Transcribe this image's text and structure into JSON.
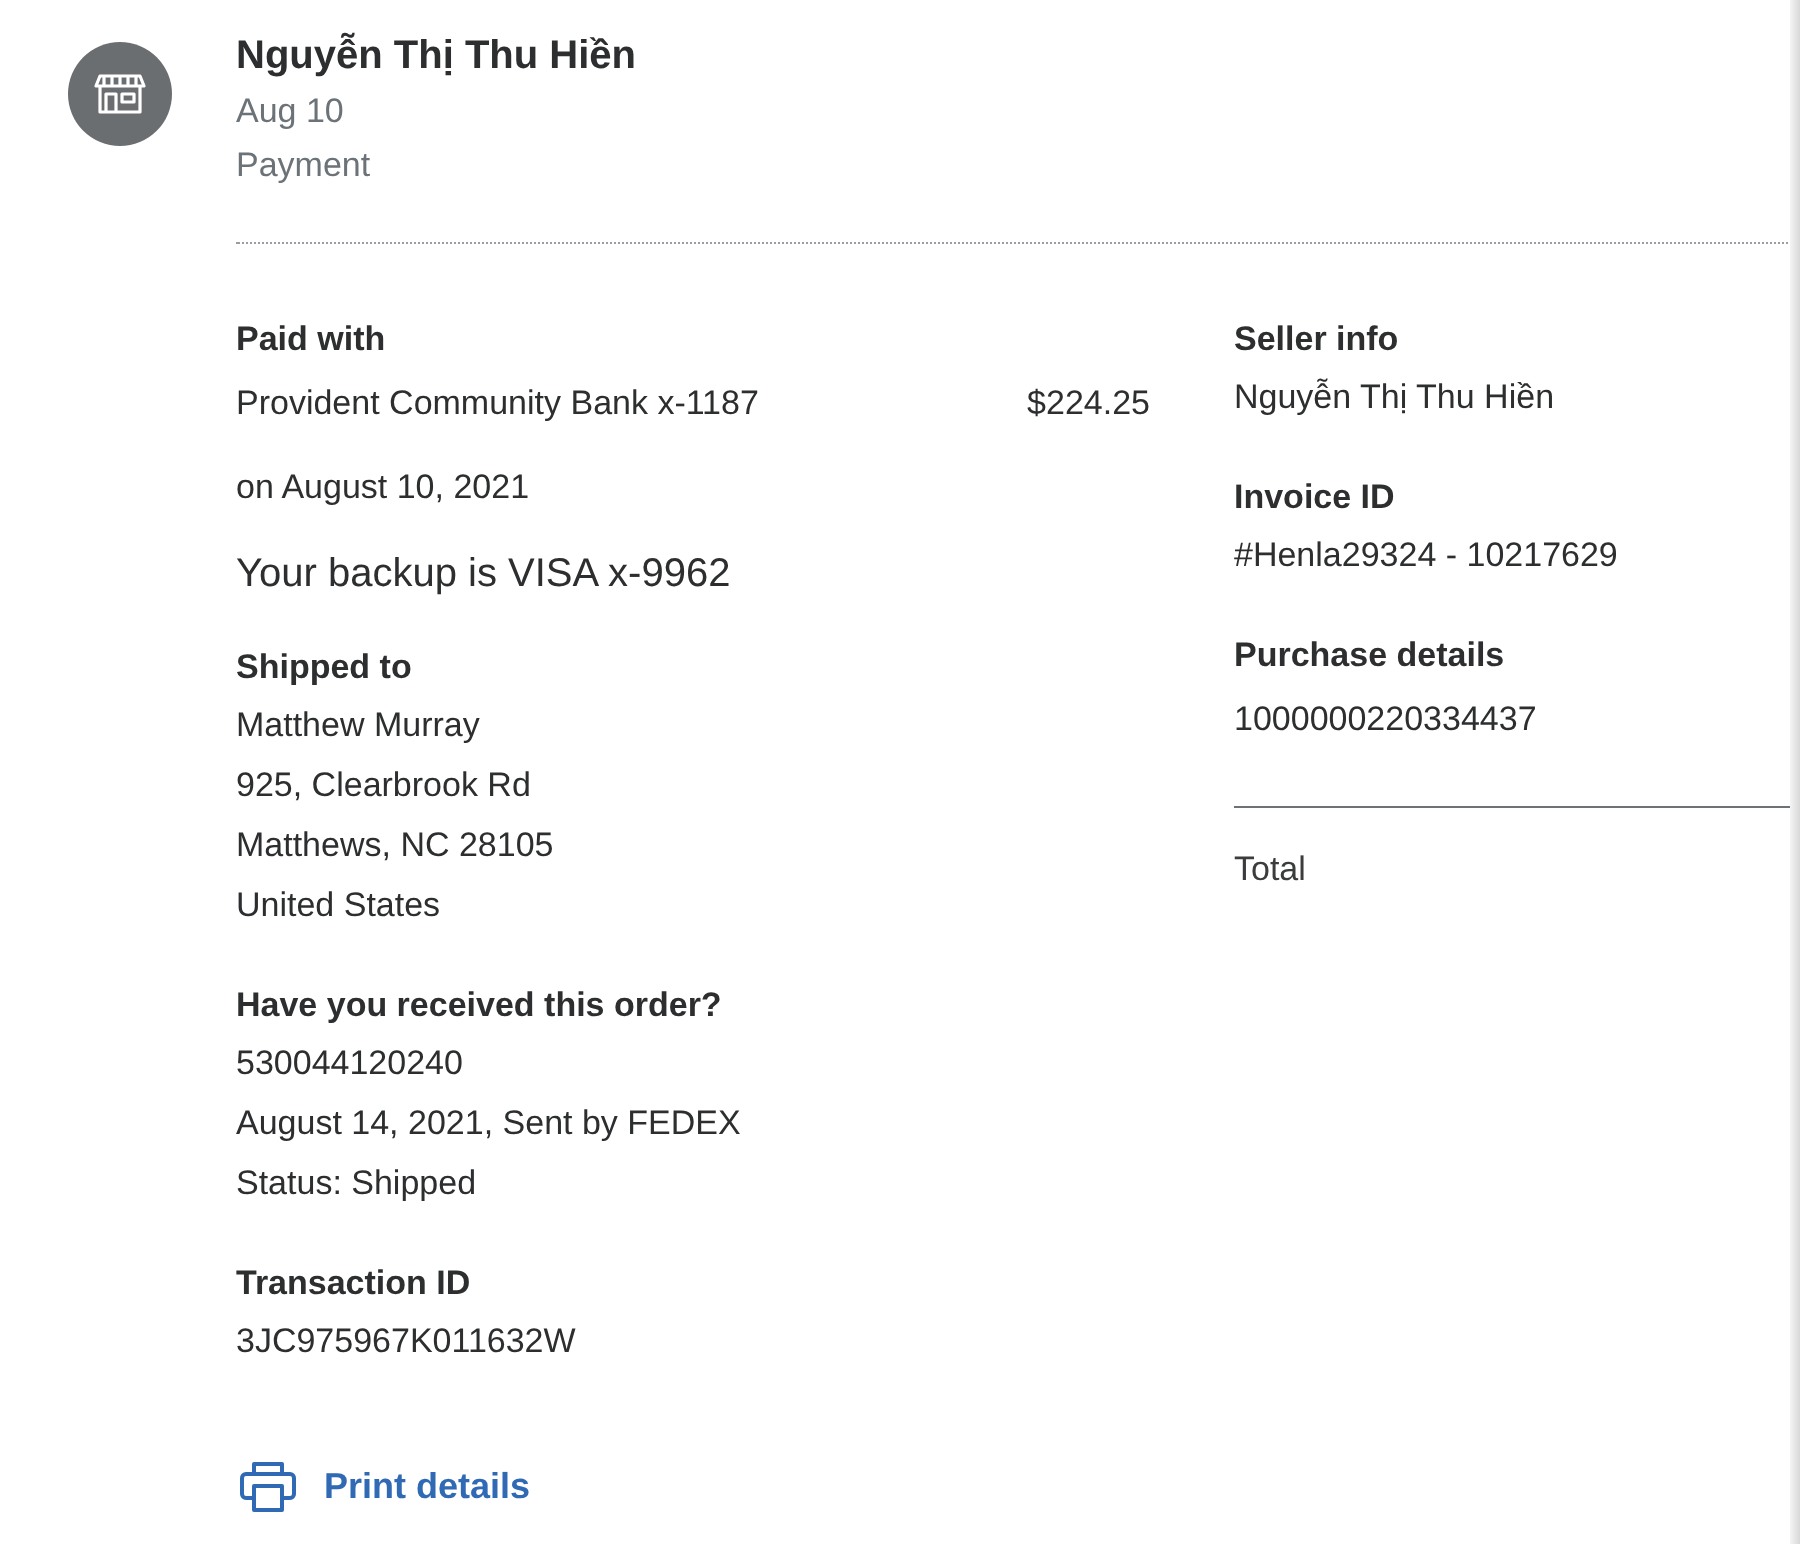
{
  "header": {
    "merchant": "Nguyễn Thị Thu Hiền",
    "date": "Aug 10",
    "type": "Payment"
  },
  "paid_with": {
    "label": "Paid with",
    "source": "Provident Community Bank x-1187",
    "amount": "$224.25",
    "date": "on August 10, 2021",
    "backup": "Your backup is VISA x-9962"
  },
  "shipped_to": {
    "label": "Shipped to",
    "lines": [
      "Matthew Murray",
      "925, Clearbrook Rd",
      "Matthews, NC 28105",
      "United States"
    ]
  },
  "order": {
    "label": "Have you received this order?",
    "lines": [
      "530044120240",
      "August 14, 2021, Sent by FEDEX",
      "Status: Shipped"
    ]
  },
  "transaction": {
    "label": "Transaction ID",
    "value": "3JC975967K011632W"
  },
  "print_link": "Print details",
  "seller_sections": [
    {
      "label": "Seller info",
      "value": "Nguyễn Thị Thu Hiền"
    },
    {
      "label": "Invoice ID",
      "value": "#Henla29324 - 10217629"
    },
    {
      "label": "Purchase details",
      "value": "1000000220334437"
    }
  ],
  "total": {
    "label": "Total"
  }
}
